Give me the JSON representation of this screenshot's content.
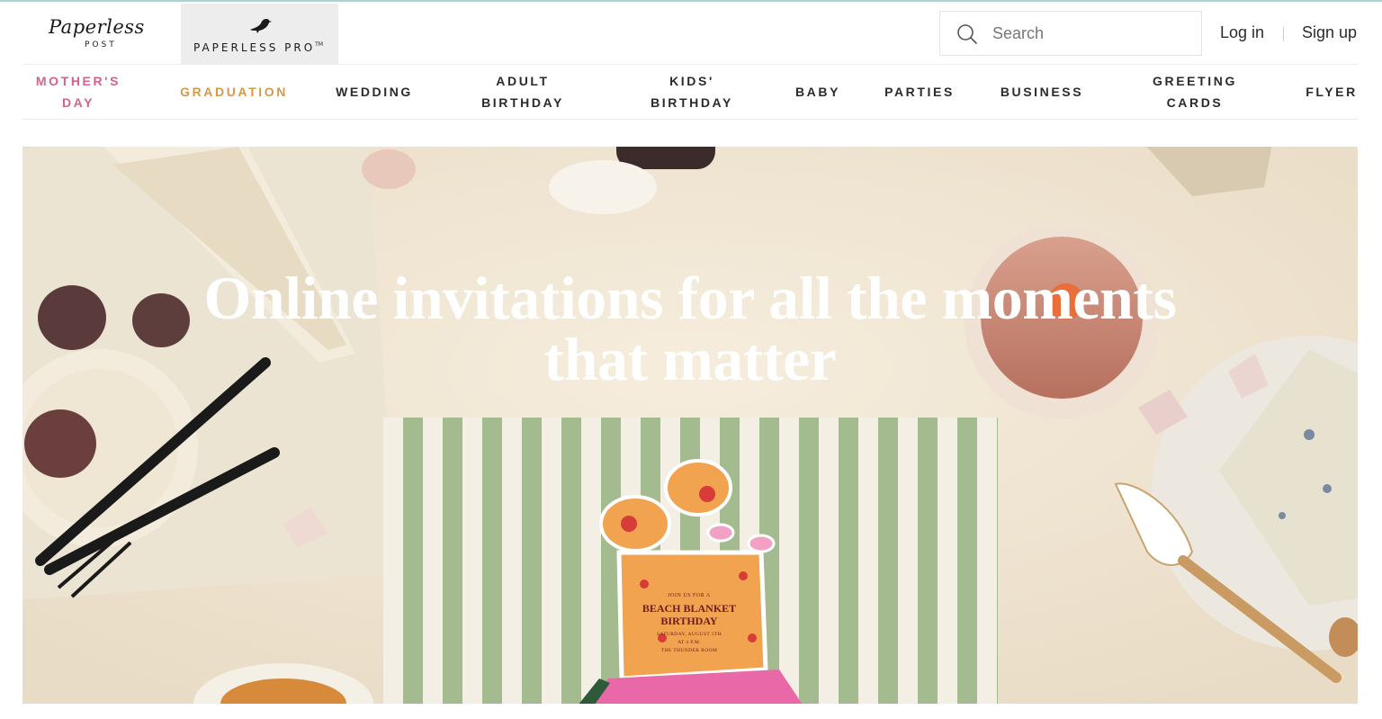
{
  "brand": {
    "logo_text": "Paperless",
    "logo_sub": "POST",
    "pro_label": "PAPERLESS PRO",
    "pro_tm": "TM"
  },
  "search": {
    "placeholder": "Search",
    "icon": "search-icon"
  },
  "auth": {
    "login_label": "Log in",
    "signup_label": "Sign up"
  },
  "nav": {
    "items": [
      {
        "label": "MOTHER'S\nDAY",
        "color": "#d4628e"
      },
      {
        "label": "GRADUATION",
        "color": "#d49a4a"
      },
      {
        "label": "WEDDING",
        "color": "#2b2b2b"
      },
      {
        "label": "ADULT\nBIRTHDAY",
        "color": "#2b2b2b"
      },
      {
        "label": "KIDS'\nBIRTHDAY",
        "color": "#2b2b2b"
      },
      {
        "label": "BABY",
        "color": "#2b2b2b"
      },
      {
        "label": "PARTIES",
        "color": "#2b2b2b"
      },
      {
        "label": "BUSINESS",
        "color": "#2b2b2b"
      },
      {
        "label": "GREETING\nCARDS",
        "color": "#2b2b2b"
      },
      {
        "label": "FLYER",
        "color": "#2b2b2b"
      }
    ]
  },
  "hero": {
    "title": "Online invitations for all the moments\nthat matter",
    "card": {
      "line1": "JOIN US FOR A",
      "line2": "BEACH BLANKET",
      "line3": "BIRTHDAY",
      "line4": "SATURDAY, AUGUST 5TH",
      "line5": "AT 4 P.M.",
      "line6": "THE THUNDER ROOM"
    }
  }
}
